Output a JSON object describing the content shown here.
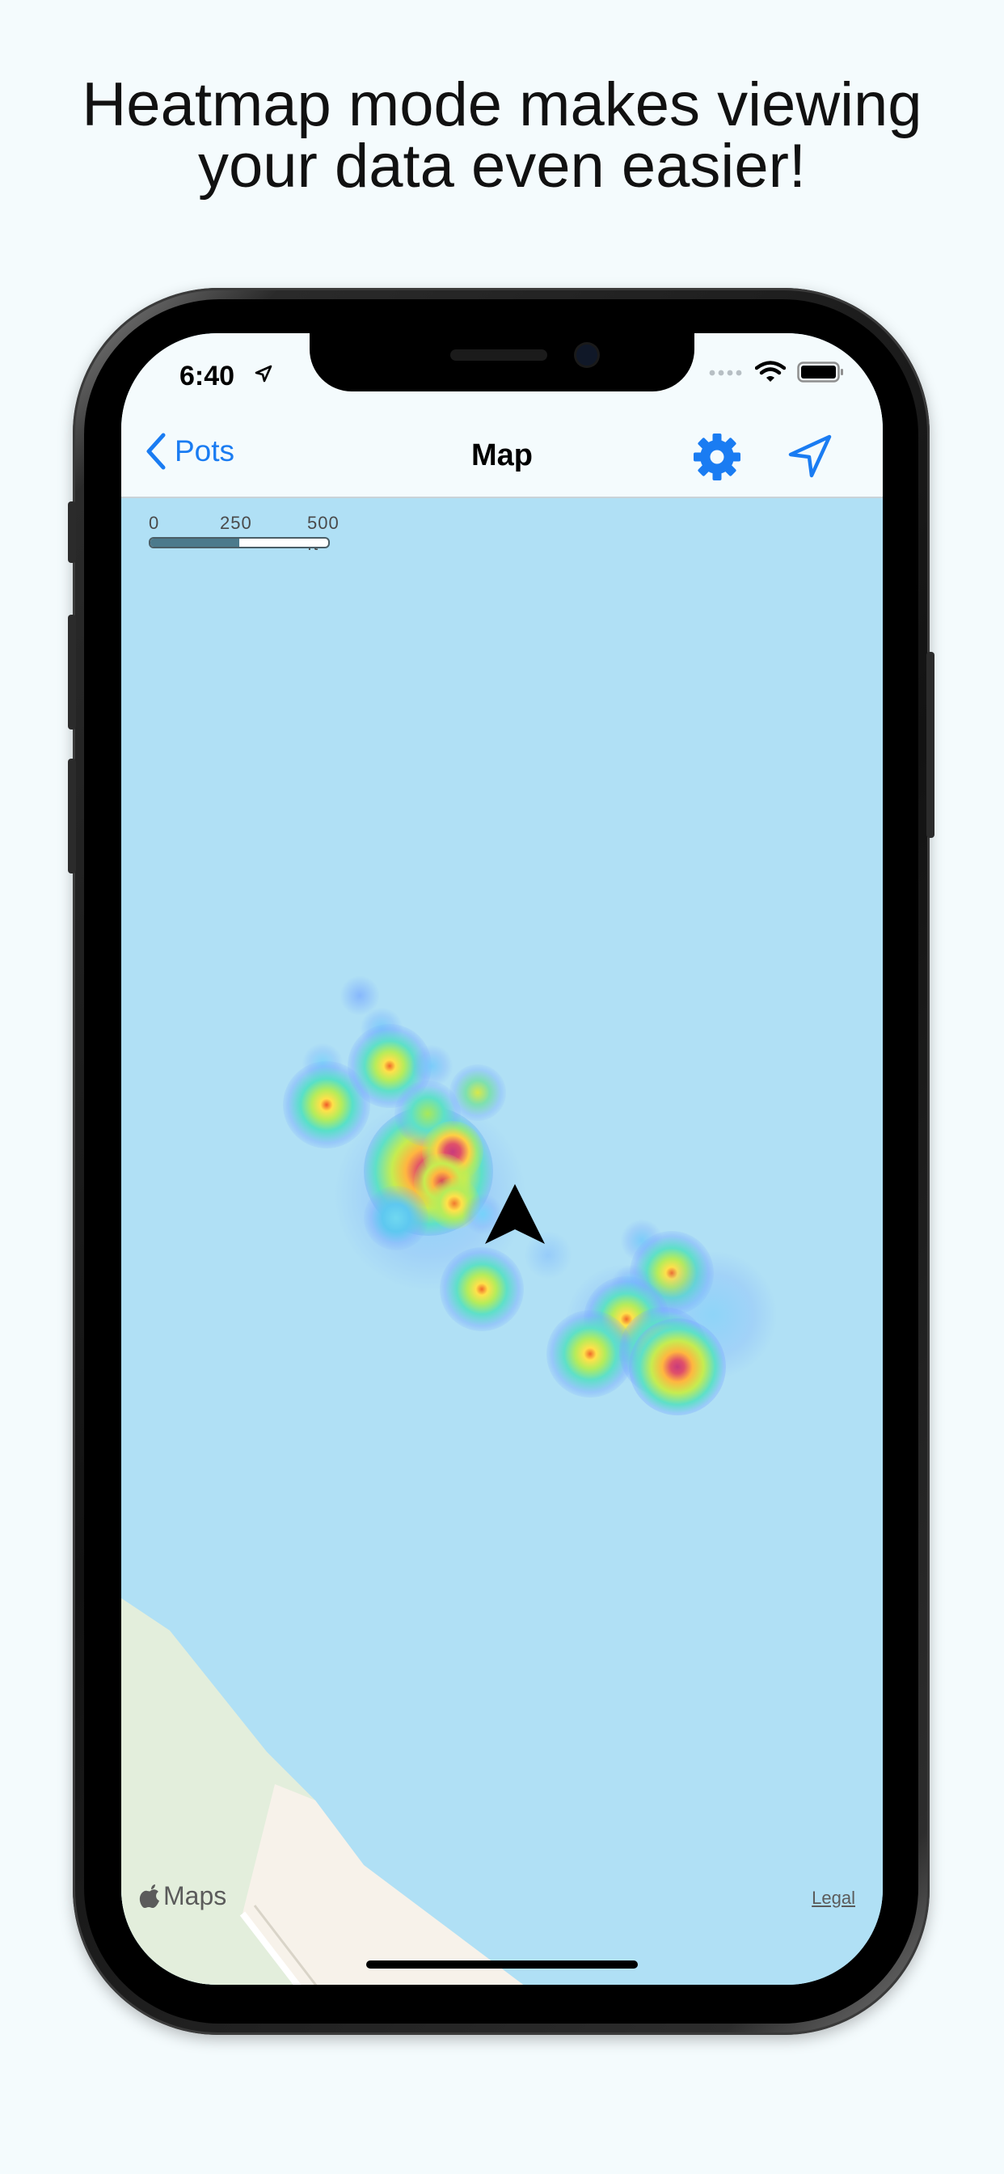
{
  "headline": {
    "line1": "Heatmap mode makes viewing",
    "line2": "your data even easier!"
  },
  "status_bar": {
    "time": "6:40",
    "icons": [
      "location-arrow-icon",
      "signal-icon",
      "wifi-icon",
      "battery-icon"
    ]
  },
  "nav": {
    "back_label": "Pots",
    "title": "Map",
    "icons": [
      "chevron-left-icon",
      "gear-icon",
      "location-arrow-icon"
    ],
    "accent_color": "#1a7cf2"
  },
  "map": {
    "scale_labels": [
      "0",
      "250",
      "500 ft"
    ],
    "attribution": "Maps",
    "legal": "Legal",
    "water_color": "#b0e0f5",
    "land_color": "#e3eedc"
  }
}
